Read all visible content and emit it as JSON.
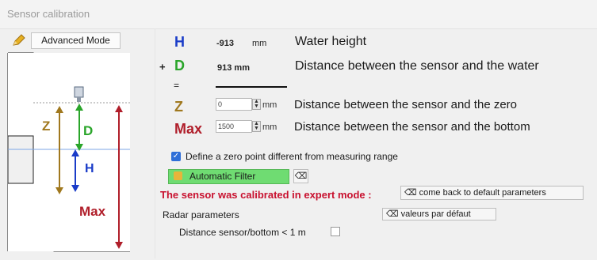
{
  "window": {
    "title": "Sensor calibration"
  },
  "toolbar": {
    "mode_button": "Advanced Mode"
  },
  "diagram": {
    "labels": {
      "z": "Z",
      "d": "D",
      "h": "H",
      "max": "Max"
    }
  },
  "rows": {
    "h": {
      "symbol": "H",
      "value": "-913",
      "unit": "mm",
      "description": "Water height"
    },
    "d": {
      "prefix": "+",
      "symbol": "D",
      "value": "913 mm",
      "description": "Distance between the sensor and the water"
    },
    "equals": "=",
    "z": {
      "symbol": "Z",
      "input_value": "0",
      "unit": "mm",
      "description": "Distance between the sensor and the zero"
    },
    "max": {
      "symbol": "Max",
      "input_value": "1500",
      "unit": "mm",
      "description": "Distance between the sensor and the bottom"
    }
  },
  "zero_point": {
    "label": "Define a zero point different from measuring range",
    "checked": true
  },
  "filter": {
    "label": "Automatic Filter"
  },
  "expert": {
    "message": "The sensor was calibrated in expert mode :",
    "back_button": "come back to default parameters"
  },
  "radar": {
    "title": "Radar parameters",
    "default_button": "valeurs par défaut",
    "distance_label": "Distance sensor/bottom < 1 m",
    "distance_checked": false
  },
  "colors": {
    "h": "#1a3cc8",
    "d": "#2aa52a",
    "z": "#a0781e",
    "max": "#b01e2a",
    "filter": "#6fdc72",
    "checkbox": "#2f6fd8",
    "expert_text": "#c8102e"
  },
  "icons": {
    "pencil": "pencil-icon",
    "backspace": "backspace-icon",
    "filter": "filter-icon",
    "spin": "spin-arrows-icon"
  }
}
